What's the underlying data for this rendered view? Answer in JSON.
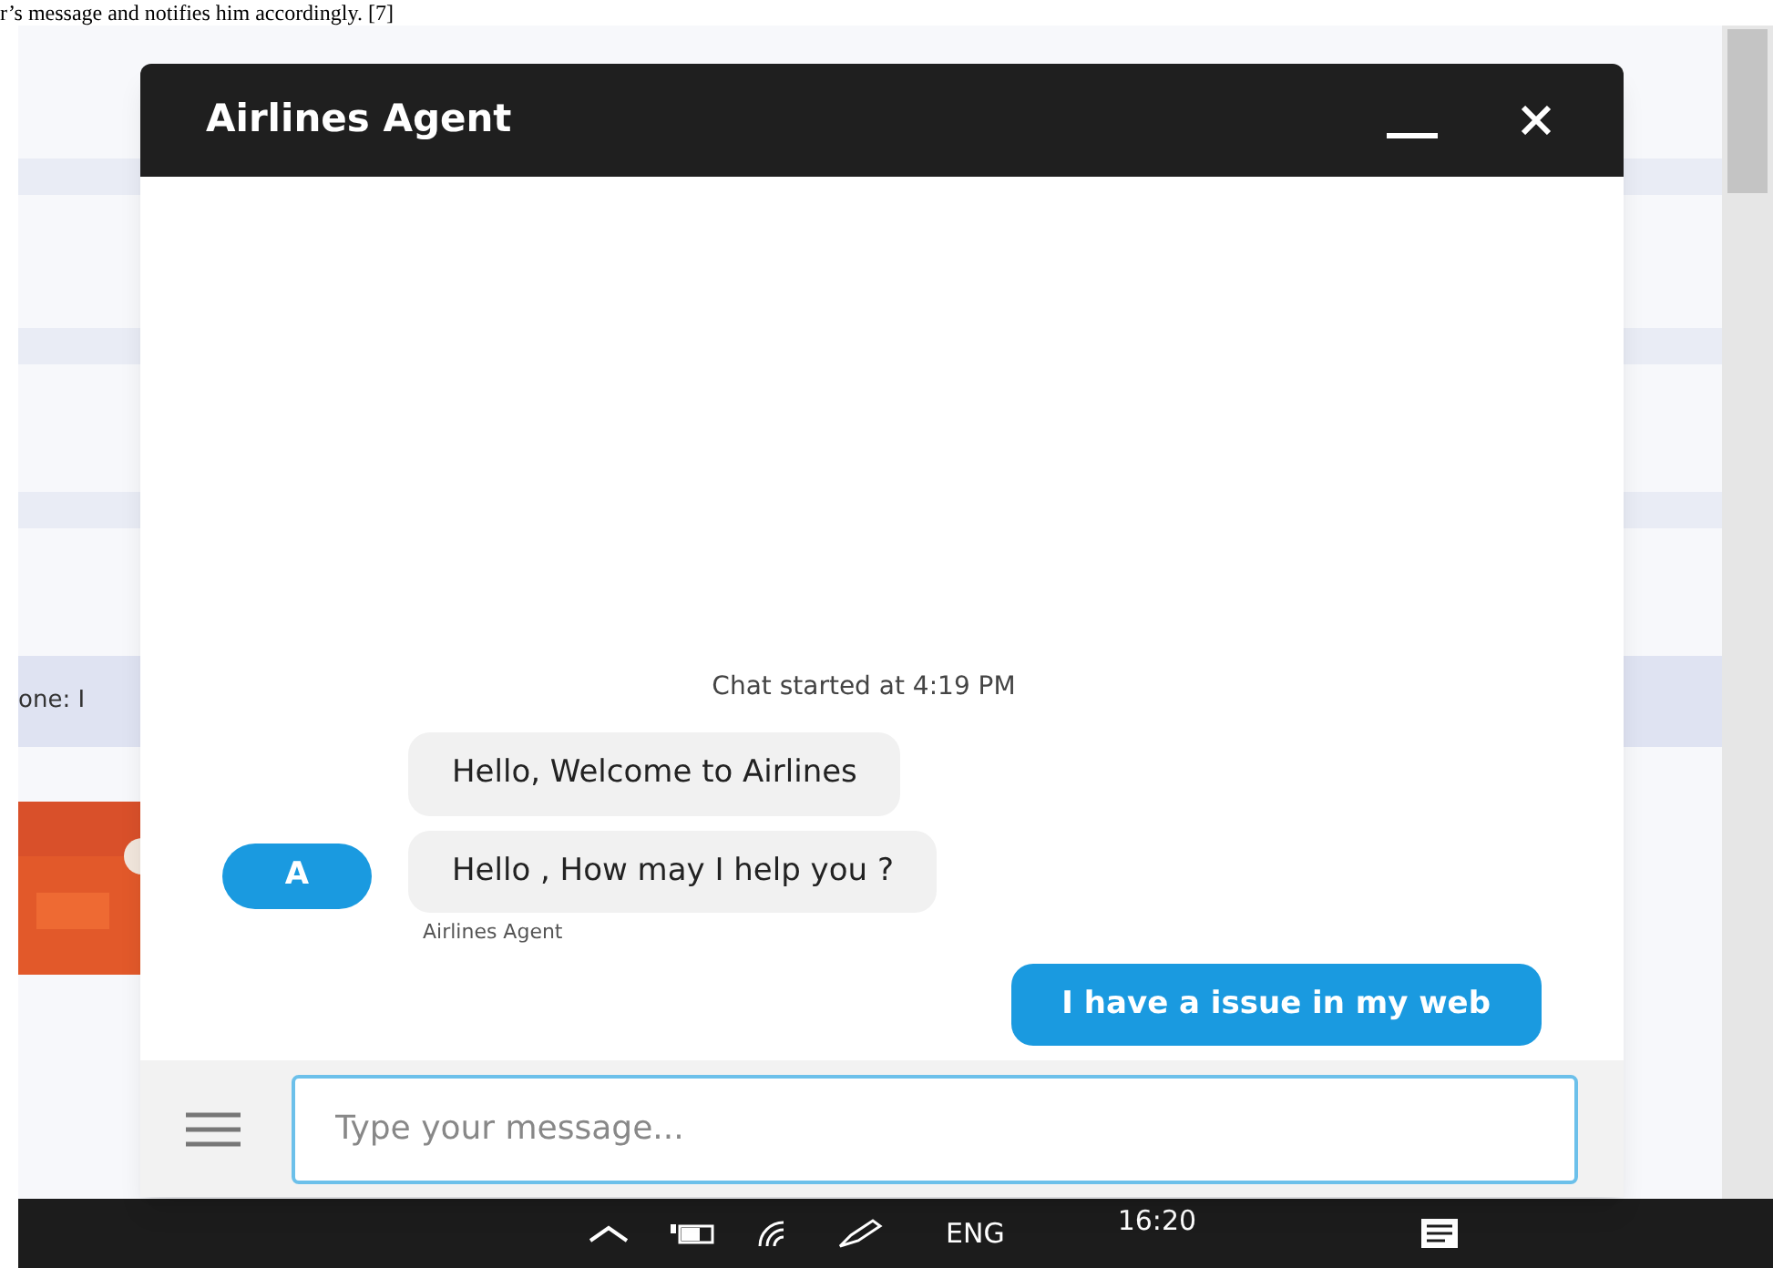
{
  "document_text": "r’s message and notifies him accordingly. [7]",
  "background_page": {
    "field_label": "one: I"
  },
  "chat": {
    "title": "Airlines Agent",
    "started": "Chat started at 4:19 PM",
    "messages": [
      {
        "kind": "agent",
        "text": "Hello, Welcome to Airlines"
      },
      {
        "kind": "agent",
        "text": "Hello , How may I help you ?"
      },
      {
        "kind": "user",
        "text": "I have a issue in my web"
      }
    ],
    "avatar": "A",
    "sender_label": "Airlines Agent",
    "input": {
      "placeholder": "Type your message..."
    }
  },
  "taskbar": {
    "language": "ENG",
    "time": "16:20"
  }
}
